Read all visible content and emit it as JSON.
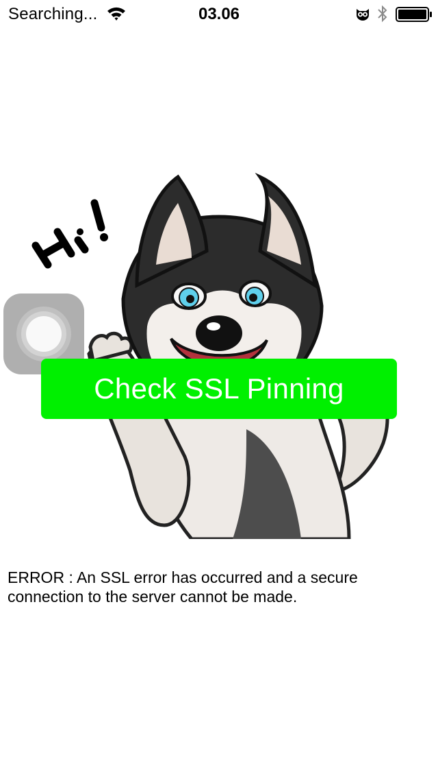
{
  "status_bar": {
    "carrier": "Searching...",
    "time": "03.06",
    "icons": [
      "wifi-icon",
      "owl-icon",
      "bluetooth-icon",
      "battery-icon"
    ]
  },
  "hero_image": {
    "text": "Hi!"
  },
  "assistive_touch": {
    "icon": "assistive-touch-icon"
  },
  "main": {
    "button_label": "Check SSL Pinning",
    "error_message": "ERROR : An SSL error has occurred and a secure connection to the server cannot be made."
  },
  "colors": {
    "button": "#00f000",
    "button_text": "#ffffff",
    "background": "#ffffff"
  }
}
